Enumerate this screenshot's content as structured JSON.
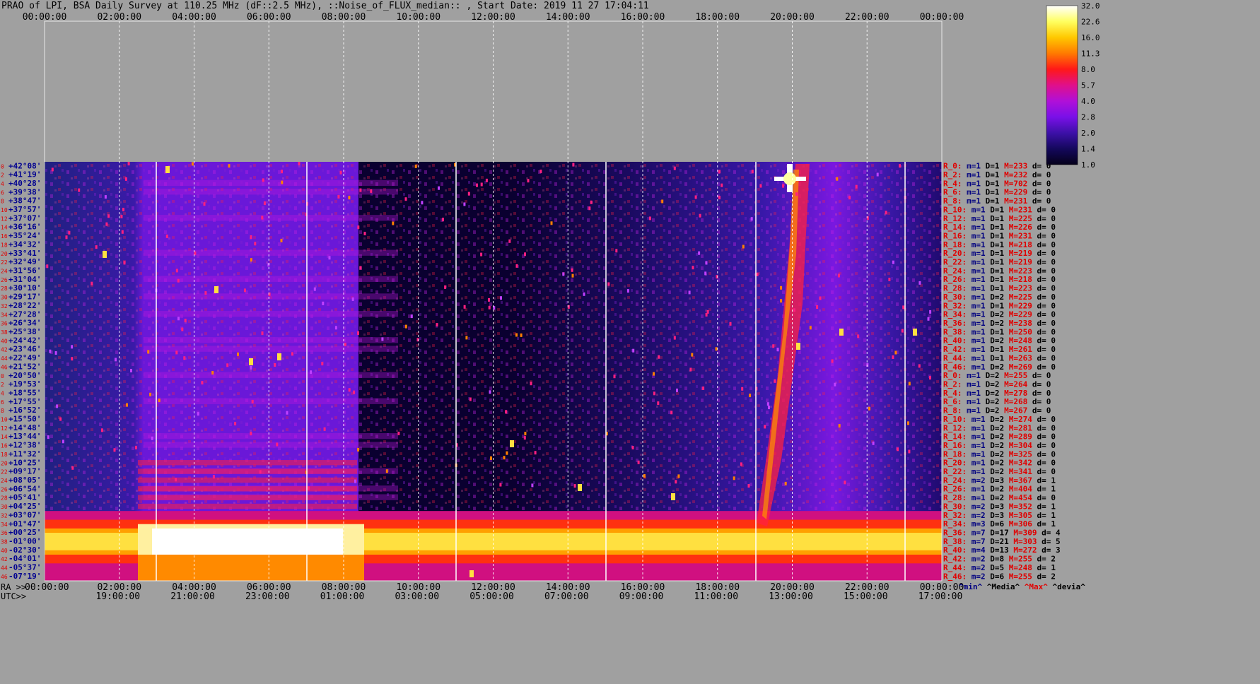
{
  "title": "PRAO of LPI, BSA Daily Survey at 110.25 MHz (dF::2.5 MHz), ::Noise_of_FLUX_median:: , Start Date: 2019 11 27 17:04:11",
  "chart_data": {
    "type": "heatmap",
    "title": "PRAO of LPI, BSA Daily Survey at 110.25 MHz (dF::2.5 MHz), ::Noise_of_FLUX_median:: , Start Date: 2019 11 27 17:04:11",
    "x_top_ticks": [
      "00:00:00",
      "02:00:00",
      "04:00:00",
      "06:00:00",
      "08:00:00",
      "10:00:00",
      "12:00:00",
      "14:00:00",
      "16:00:00",
      "18:00:00",
      "20:00:00",
      "22:00:00",
      "00:00:00"
    ],
    "x_bottom_ra_ticks": [
      "00:00:00",
      "02:00:00",
      "04:00:00",
      "06:00:00",
      "08:00:00",
      "10:00:00",
      "12:00:00",
      "14:00:00",
      "16:00:00",
      "18:00:00",
      "20:00:00",
      "22:00:00",
      "00:00:00"
    ],
    "x_bottom_utc_ticks": [
      "19:00:00",
      "21:00:00",
      "23:00:00",
      "01:00:00",
      "03:00:00",
      "05:00:00",
      "07:00:00",
      "09:00:00",
      "11:00:00",
      "13:00:00",
      "15:00:00",
      "17:00:00"
    ],
    "ra_label": "RA >>",
    "utc_label": "UTC>>",
    "declinations": [
      "+42°08'",
      "+41°19'",
      "+40°28'",
      "+39°38'",
      "+38°47'",
      "+37°57'",
      "+37°07'",
      "+36°16'",
      "+35°24'",
      "+34°32'",
      "+33°41'",
      "+32°49'",
      "+31°56'",
      "+31°04'",
      "+30°10'",
      "+29°17'",
      "+28°22'",
      "+27°28'",
      "+26°34'",
      "+25°38'",
      "+24°42'",
      "+23°46'",
      "+22°49'",
      "+21°52'",
      "+20°50'",
      "+19°53'",
      "+18°55'",
      "+17°55'",
      "+16°52'",
      "+15°50'",
      "+14°48'",
      "+13°44'",
      "+12°38'",
      "+11°32'",
      "+10°25'",
      "+09°17'",
      "+08°05'",
      "+06°54'",
      "+05°41'",
      "+04°25'",
      "+03°07'",
      "+01°47'",
      "+00°25'",
      "-01°00'",
      "-02°30'",
      "-04°01'",
      "-05°37'",
      "-07°19'"
    ],
    "beam_stats": [
      {
        "r": "R_0:",
        "m": "m=1",
        "d": "D=1",
        "M": "M=233",
        "dev": "d= 0"
      },
      {
        "r": "R_2:",
        "m": "m=1",
        "d": "D=1",
        "M": "M=232",
        "dev": "d= 0"
      },
      {
        "r": "R_4:",
        "m": "m=1",
        "d": "D=1",
        "M": "M=702",
        "dev": "d= 0"
      },
      {
        "r": "R_6:",
        "m": "m=1",
        "d": "D=1",
        "M": "M=229",
        "dev": "d= 0"
      },
      {
        "r": "R_8:",
        "m": "m=1",
        "d": "D=1",
        "M": "M=231",
        "dev": "d= 0"
      },
      {
        "r": "R_10:",
        "m": "m=1",
        "d": "D=1",
        "M": "M=231",
        "dev": "d= 0"
      },
      {
        "r": "R_12:",
        "m": "m=1",
        "d": "D=1",
        "M": "M=225",
        "dev": "d= 0"
      },
      {
        "r": "R_14:",
        "m": "m=1",
        "d": "D=1",
        "M": "M=226",
        "dev": "d= 0"
      },
      {
        "r": "R_16:",
        "m": "m=1",
        "d": "D=1",
        "M": "M=231",
        "dev": "d= 0"
      },
      {
        "r": "R_18:",
        "m": "m=1",
        "d": "D=1",
        "M": "M=218",
        "dev": "d= 0"
      },
      {
        "r": "R_20:",
        "m": "m=1",
        "d": "D=1",
        "M": "M=219",
        "dev": "d= 0"
      },
      {
        "r": "R_22:",
        "m": "m=1",
        "d": "D=1",
        "M": "M=219",
        "dev": "d= 0"
      },
      {
        "r": "R_24:",
        "m": "m=1",
        "d": "D=1",
        "M": "M=223",
        "dev": "d= 0"
      },
      {
        "r": "R_26:",
        "m": "m=1",
        "d": "D=1",
        "M": "M=218",
        "dev": "d= 0"
      },
      {
        "r": "R_28:",
        "m": "m=1",
        "d": "D=1",
        "M": "M=223",
        "dev": "d= 0"
      },
      {
        "r": "R_30:",
        "m": "m=1",
        "d": "D=2",
        "M": "M=225",
        "dev": "d= 0"
      },
      {
        "r": "R_32:",
        "m": "m=1",
        "d": "D=1",
        "M": "M=229",
        "dev": "d= 0"
      },
      {
        "r": "R_34:",
        "m": "m=1",
        "d": "D=2",
        "M": "M=229",
        "dev": "d= 0"
      },
      {
        "r": "R_36:",
        "m": "m=1",
        "d": "D=2",
        "M": "M=238",
        "dev": "d= 0"
      },
      {
        "r": "R_38:",
        "m": "m=1",
        "d": "D=1",
        "M": "M=250",
        "dev": "d= 0"
      },
      {
        "r": "R_40:",
        "m": "m=1",
        "d": "D=2",
        "M": "M=248",
        "dev": "d= 0"
      },
      {
        "r": "R_42:",
        "m": "m=1",
        "d": "D=1",
        "M": "M=261",
        "dev": "d= 0"
      },
      {
        "r": "R_44:",
        "m": "m=1",
        "d": "D=1",
        "M": "M=263",
        "dev": "d= 0"
      },
      {
        "r": "R_46:",
        "m": "m=1",
        "d": "D=2",
        "M": "M=269",
        "dev": "d= 0"
      },
      {
        "r": "R_0:",
        "m": "m=1",
        "d": "D=2",
        "M": "M=255",
        "dev": "d= 0"
      },
      {
        "r": "R_2:",
        "m": "m=1",
        "d": "D=2",
        "M": "M=264",
        "dev": "d= 0"
      },
      {
        "r": "R_4:",
        "m": "m=1",
        "d": "D=2",
        "M": "M=278",
        "dev": "d= 0"
      },
      {
        "r": "R_6:",
        "m": "m=1",
        "d": "D=2",
        "M": "M=268",
        "dev": "d= 0"
      },
      {
        "r": "R_8:",
        "m": "m=1",
        "d": "D=2",
        "M": "M=267",
        "dev": "d= 0"
      },
      {
        "r": "R_10:",
        "m": "m=1",
        "d": "D=2",
        "M": "M=274",
        "dev": "d= 0"
      },
      {
        "r": "R_12:",
        "m": "m=1",
        "d": "D=2",
        "M": "M=281",
        "dev": "d= 0"
      },
      {
        "r": "R_14:",
        "m": "m=1",
        "d": "D=2",
        "M": "M=289",
        "dev": "d= 0"
      },
      {
        "r": "R_16:",
        "m": "m=1",
        "d": "D=2",
        "M": "M=304",
        "dev": "d= 0"
      },
      {
        "r": "R_18:",
        "m": "m=1",
        "d": "D=2",
        "M": "M=325",
        "dev": "d= 0"
      },
      {
        "r": "R_20:",
        "m": "m=1",
        "d": "D=2",
        "M": "M=342",
        "dev": "d= 0"
      },
      {
        "r": "R_22:",
        "m": "m=1",
        "d": "D=2",
        "M": "M=341",
        "dev": "d= 0"
      },
      {
        "r": "R_24:",
        "m": "m=2",
        "d": "D=3",
        "M": "M=367",
        "dev": "d= 1"
      },
      {
        "r": "R_26:",
        "m": "m=1",
        "d": "D=2",
        "M": "M=404",
        "dev": "d= 1"
      },
      {
        "r": "R_28:",
        "m": "m=1",
        "d": "D=2",
        "M": "M=454",
        "dev": "d= 0"
      },
      {
        "r": "R_30:",
        "m": "m=2",
        "d": "D=3",
        "M": "M=352",
        "dev": "d= 1"
      },
      {
        "r": "R_32:",
        "m": "m=2",
        "d": "D=3",
        "M": "M=305",
        "dev": "d= 1"
      },
      {
        "r": "R_34:",
        "m": "m=3",
        "d": "D=6",
        "M": "M=306",
        "dev": "d= 1"
      },
      {
        "r": "R_36:",
        "m": "m=7",
        "d": "D=17",
        "M": "M=309",
        "dev": "d= 4"
      },
      {
        "r": "R_38:",
        "m": "m=7",
        "d": "D=21",
        "M": "M=303",
        "dev": "d= 5"
      },
      {
        "r": "R_40:",
        "m": "m=4",
        "d": "D=13",
        "M": "M=272",
        "dev": "d= 3"
      },
      {
        "r": "R_42:",
        "m": "m=2",
        "d": "D=8",
        "M": "M=255",
        "dev": "d= 2"
      },
      {
        "r": "R_44:",
        "m": "m=2",
        "d": "D=5",
        "M": "M=248",
        "dev": "d= 1"
      },
      {
        "r": "R_46:",
        "m": "m=2",
        "d": "D=6",
        "M": "M=255",
        "dev": "d= 2"
      }
    ],
    "stats_legend": [
      "^min^",
      "^Media^",
      "^Max^",
      "^devia^"
    ],
    "colorbar": {
      "ticks": [
        "32.0",
        "22.6",
        "16.0",
        "11.3",
        "8.0",
        "5.7",
        "4.0",
        "2.8",
        "2.0",
        "1.4",
        "1.0"
      ],
      "scale": "log",
      "range": [
        1.0,
        32.0
      ],
      "colors": [
        "#05001a",
        "#14085c",
        "#3d10a8",
        "#7a10e8",
        "#b010d8",
        "#e0108a",
        "#ff1818",
        "#ff7a00",
        "#ffc800",
        "#ffff60",
        "#ffffff"
      ]
    },
    "row_count_left": [
      "0",
      "2",
      "4",
      "6",
      "8",
      "10",
      "12",
      "14",
      "16",
      "18",
      "20",
      "22",
      "24",
      "26",
      "28",
      "30",
      "32",
      "34",
      "36",
      "38",
      "40",
      "42",
      "44",
      "46",
      "0",
      "2",
      "4",
      "6",
      "8",
      "10",
      "12",
      "14",
      "16",
      "18",
      "20",
      "22",
      "24",
      "26",
      "28",
      "30",
      "32",
      "34",
      "36",
      "38",
      "40",
      "42",
      "44",
      "46"
    ],
    "colors": {
      "beam": "#e00000",
      "m": "#000080",
      "D": "#000000",
      "M": "#e00000",
      "d": "#000000",
      "dec": "#000090"
    }
  }
}
